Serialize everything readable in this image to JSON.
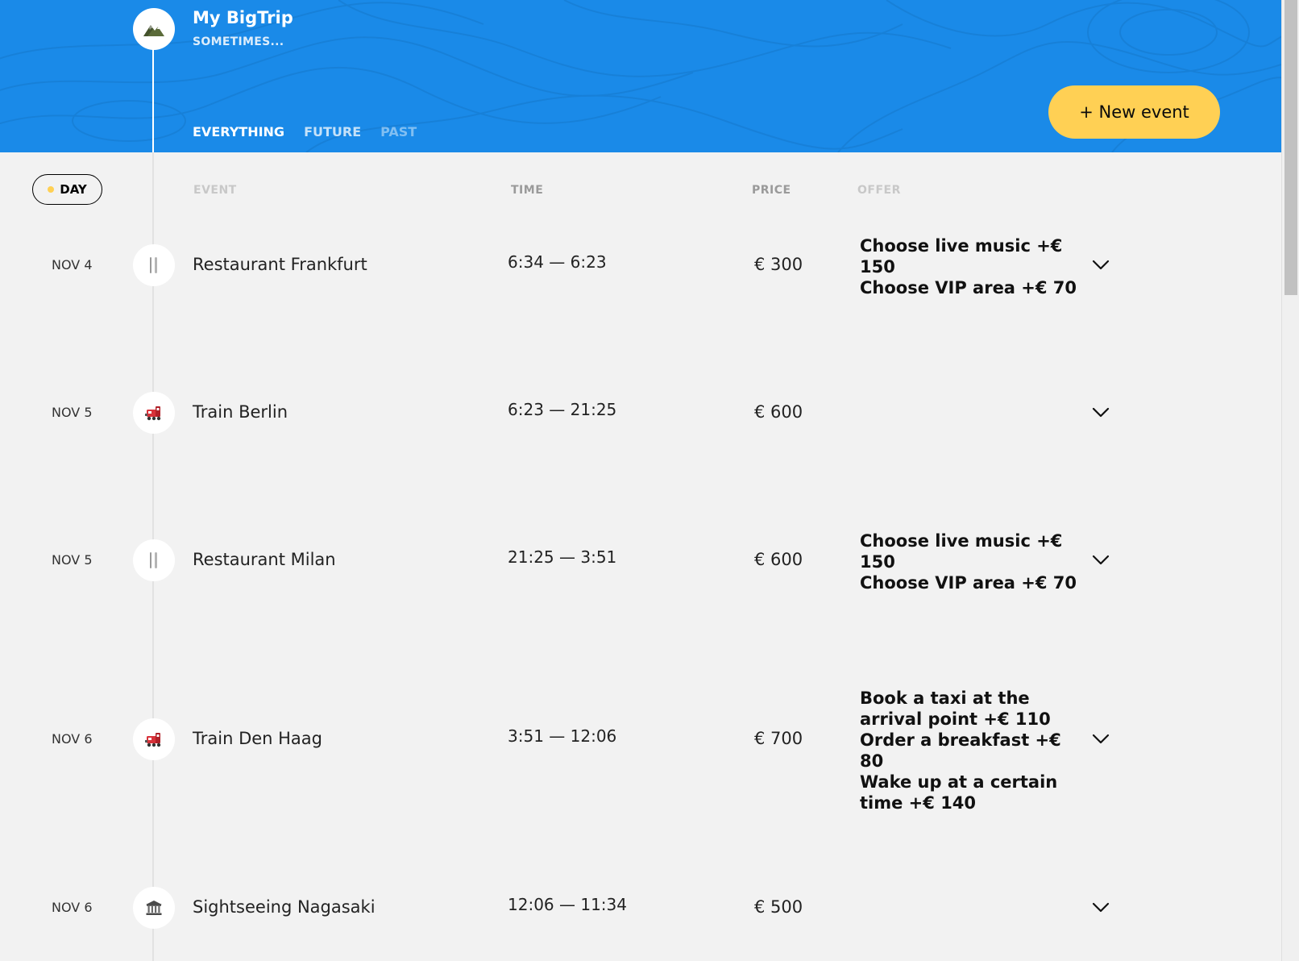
{
  "header": {
    "title": "My BigTrip",
    "subtitle": "SOMETIMES...",
    "logo_icon": "mountains-icon",
    "background_color": "#1a8ae8",
    "filters": [
      {
        "label": "EVERYTHING",
        "state": "active"
      },
      {
        "label": "FUTURE",
        "state": "inactive"
      },
      {
        "label": "PAST",
        "state": "disabled"
      }
    ],
    "new_event_label": "+ New event",
    "accent_color": "#ffd054"
  },
  "table": {
    "day_label": "DAY",
    "columns": {
      "event": "EVENT",
      "time": "TIME",
      "price": "PRICE",
      "offer": "OFFER"
    }
  },
  "events": [
    {
      "date": "NOV 4",
      "icon": "fork-knife-icon",
      "name": "Restaurant Frankfurt",
      "time": "6:34 — 6:23",
      "price": "€ 300",
      "offers": [
        "Choose live music +€ 150",
        "Choose VIP area +€  70"
      ]
    },
    {
      "date": "NOV 5",
      "icon": "train-icon",
      "name": "Train Berlin",
      "time": "6:23 — 21:25",
      "price": "€ 600",
      "offers": []
    },
    {
      "date": "NOV 5",
      "icon": "fork-knife-icon",
      "name": "Restaurant Milan",
      "time": "21:25 — 3:51",
      "price": "€ 600",
      "offers": [
        "Choose live music +€ 150",
        "Choose VIP area +€  70"
      ]
    },
    {
      "date": "NOV 6",
      "icon": "train-icon",
      "name": "Train Den Haag",
      "time": "3:51 — 12:06",
      "price": "€ 700",
      "offers": [
        "Book a taxi at the arrival point +€  110",
        "Order a breakfast +€  80",
        "Wake up at a certain time +€  140"
      ]
    },
    {
      "date": "NOV 6",
      "icon": "museum-icon",
      "name": "Sightseeing Nagasaki",
      "time": "12:06 — 11:34",
      "price": "€ 500",
      "offers": []
    }
  ]
}
